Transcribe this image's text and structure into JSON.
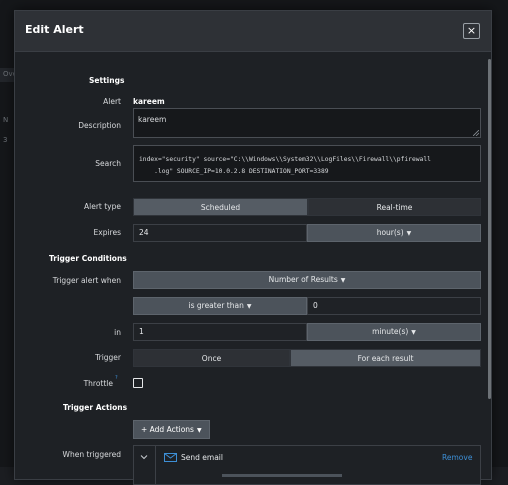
{
  "background": {
    "fragments": [
      "Ove",
      "N",
      "3"
    ]
  },
  "modal": {
    "title": "Edit Alert",
    "close_label": "×"
  },
  "settings": {
    "section_title": "Settings",
    "alert_label": "Alert",
    "alert_value": "kareem",
    "description_label": "Description",
    "description_value": "kareem",
    "search_label": "Search",
    "search_value": "index=\"security\" source=\"C:\\\\Windows\\\\System32\\\\LogFiles\\\\Firewall\\\\pfirewall\n    .log\" SOURCE_IP=10.0.2.8 DESTINATION_PORT=3389",
    "alert_type_label": "Alert type",
    "alert_type_options": [
      "Scheduled",
      "Real-time"
    ],
    "alert_type_selected": "Scheduled",
    "expires_label": "Expires",
    "expires_value": "24",
    "expires_unit": "hour(s)"
  },
  "trigger": {
    "section_title": "Trigger Conditions",
    "trigger_when_label": "Trigger alert when",
    "trigger_when_value": "Number of Results",
    "comparator_value": "is greater than",
    "threshold_value": "0",
    "in_label": "in",
    "in_value": "1",
    "in_unit": "minute(s)",
    "trigger_label": "Trigger",
    "trigger_options": [
      "Once",
      "For each result"
    ],
    "trigger_selected": "For each result",
    "throttle_label": "Throttle",
    "throttle_marker": "?",
    "throttle_checked": false
  },
  "actions": {
    "section_title": "Trigger Actions",
    "add_button_label": "+ Add Actions",
    "when_triggered_label": "When triggered",
    "action_name": "Send email",
    "remove_label": "Remove"
  },
  "colors": {
    "accent_link": "#3d8fd6",
    "active_segment": "#555c64",
    "dropdown": "#4c535b"
  }
}
